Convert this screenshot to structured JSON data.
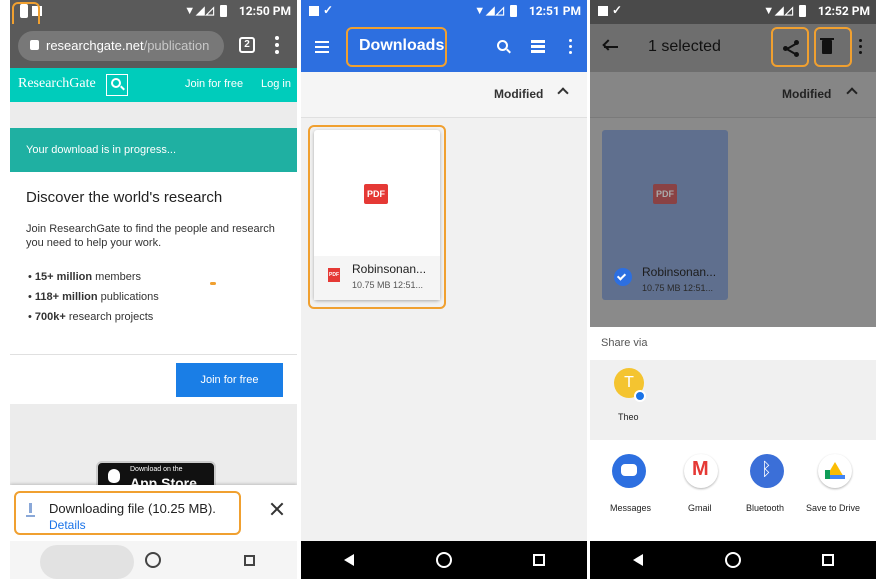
{
  "screen1": {
    "status_time": "12:50 PM",
    "url_host": "researchgate.net",
    "url_path": "/publication",
    "tab_count": "2",
    "site_name": "ResearchGate",
    "join_link": "Join for free",
    "login_link": "Log in",
    "banner_text": "Your download is in progress...",
    "heading": "Discover the world's research",
    "description": "Join ResearchGate to find the people and research you need to help your work.",
    "stats": [
      {
        "bold": "15+ million",
        "rest": " members"
      },
      {
        "bold": "118+ million",
        "rest": " publications"
      },
      {
        "bold": "700k+",
        "rest": " research projects"
      }
    ],
    "join_button": "Join for free",
    "appstore_small": "Download on the",
    "appstore_big": "App Store",
    "download_text": "Downloading file (10.25 MB).",
    "details_link": "Details"
  },
  "screen2": {
    "status_time": "12:51 PM",
    "title": "Downloads",
    "sort_label": "Modified",
    "file": {
      "badge": "PDF",
      "name": "Robinsonan...",
      "meta": "10.75 MB 12:51..."
    }
  },
  "screen3": {
    "status_time": "12:52 PM",
    "selection_title": "1 selected",
    "sort_label": "Modified",
    "file": {
      "badge": "PDF",
      "name": "Robinsonan...",
      "meta": "10.75 MB 12:51..."
    },
    "share_label": "Share via",
    "contact": {
      "initial": "T",
      "name": "Theo"
    },
    "apps": [
      {
        "name": "Messages"
      },
      {
        "name": "Gmail"
      },
      {
        "name": "Bluetooth"
      },
      {
        "name": "Save to Drive"
      }
    ]
  },
  "colors": {
    "researchgate_teal": "#00ccbb",
    "banner_teal": "#1fb0a2",
    "blue_toolbar": "#2d6fe0",
    "join_button_blue": "#1a7ee6",
    "highlight_orange": "#f0a030",
    "pdf_red": "#e53935"
  }
}
